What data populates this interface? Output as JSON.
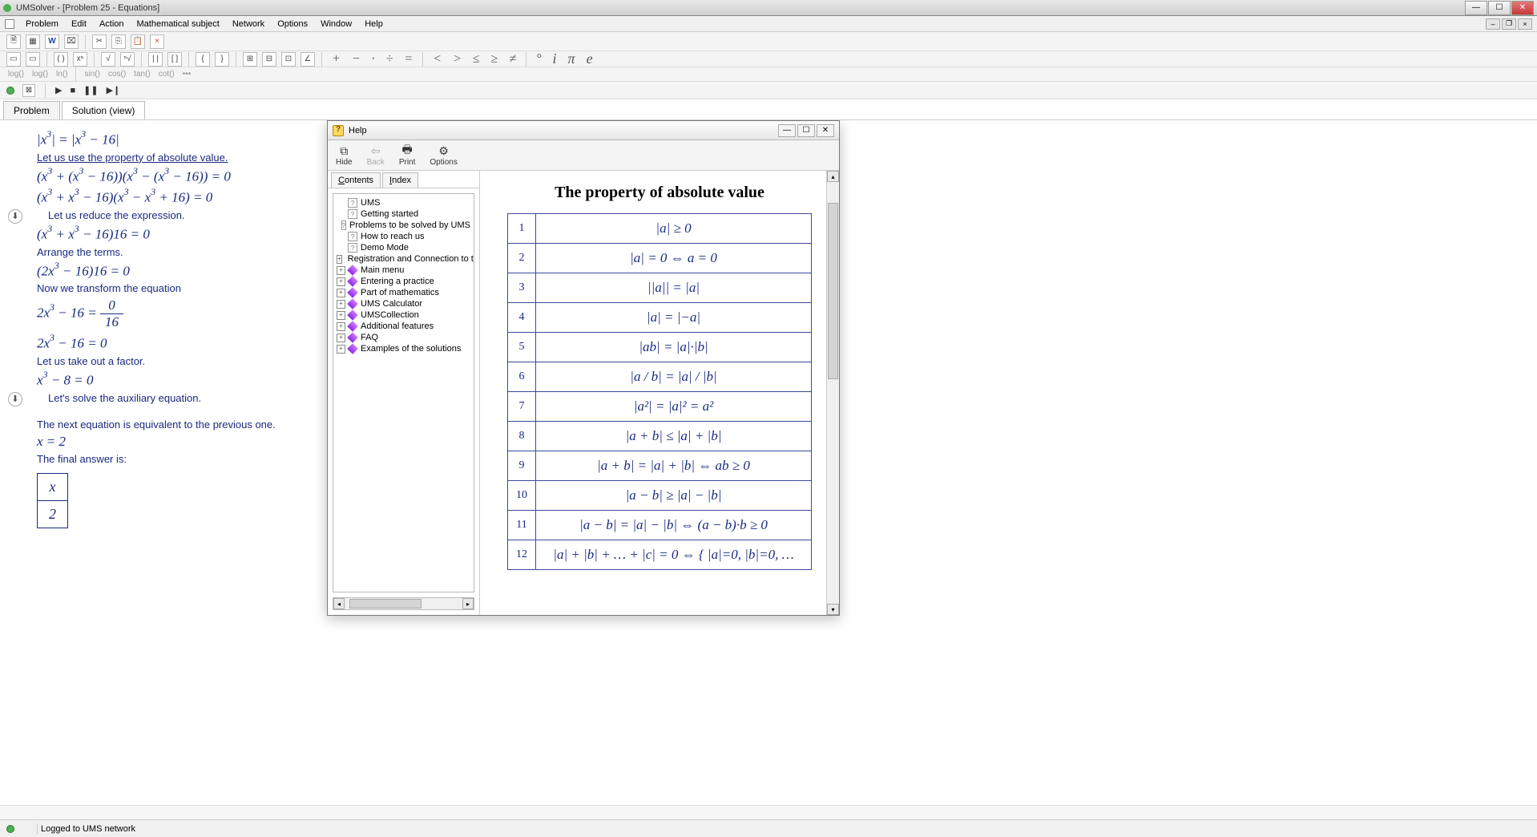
{
  "window": {
    "title": "UMSolver - [Problem 25 - Equations]"
  },
  "menu": {
    "items": [
      "Problem",
      "Edit",
      "Action",
      "Mathematical subject",
      "Network",
      "Options",
      "Window",
      "Help"
    ]
  },
  "toolbar2_funcs": [
    "log()",
    "log()",
    "ln()",
    "sin()",
    "cos()",
    "tan()",
    "cot()",
    "•••"
  ],
  "doc_tabs": {
    "problem": "Problem",
    "solution": "Solution (view)"
  },
  "solution": {
    "eq_top": "|x³| = |x³ − 16|",
    "s1": "Let us use the property of absolute value.",
    "eq2": "(x³ + (x³ − 16))(x³ − (x³ − 16)) = 0",
    "eq3": "(x³ + x³ − 16)(x³ − x³ + 16) = 0",
    "s2": "Let us reduce the expression.",
    "eq4": "(x³ + x³ − 16)16 = 0",
    "s3": "Arrange the terms.",
    "eq5": "(2x³ − 16)16 = 0",
    "s4": "Now we transform the equation",
    "eq6_lhs": "2x³ − 16",
    "eq6_num": "0",
    "eq6_den": "16",
    "eq7": "2x³ − 16 = 0",
    "s5": "Let us take out a factor.",
    "eq8": "x³ − 8 = 0",
    "s6": "Let's solve the auxiliary equation.",
    "s7": "The next equation is equivalent to the previous one.",
    "eq9": "x = 2",
    "s8": "The final answer is:",
    "ans_var": "x",
    "ans_val": "2"
  },
  "help": {
    "title": "Help",
    "toolbar": {
      "hide": "Hide",
      "back": "Back",
      "print": "Print",
      "options": "Options"
    },
    "nav_tabs": {
      "contents": "Contents",
      "index": "Index"
    },
    "tree": [
      {
        "kind": "q",
        "label": "UMS"
      },
      {
        "kind": "q",
        "label": "Getting started"
      },
      {
        "kind": "q",
        "label": "Problems to be solved by UMS"
      },
      {
        "kind": "q",
        "label": "How to reach us"
      },
      {
        "kind": "q",
        "label": "Demo Mode"
      },
      {
        "kind": "b",
        "exp": true,
        "label": "Registration and Connection to the UMS"
      },
      {
        "kind": "b",
        "exp": true,
        "label": "Main menu"
      },
      {
        "kind": "b",
        "exp": true,
        "label": "Entering a practice"
      },
      {
        "kind": "b",
        "exp": true,
        "label": "Part of mathematics"
      },
      {
        "kind": "b",
        "exp": true,
        "label": "UMS Calculator"
      },
      {
        "kind": "b",
        "exp": true,
        "label": "UMSCollection"
      },
      {
        "kind": "b",
        "exp": true,
        "label": "Additional features"
      },
      {
        "kind": "b",
        "exp": true,
        "label": "FAQ"
      },
      {
        "kind": "b",
        "exp": true,
        "label": "Examples of the solutions"
      }
    ],
    "article_title": "The property of absolute value",
    "rows": [
      {
        "n": "1",
        "f": "|a| ≥ 0"
      },
      {
        "n": "2",
        "f": "|a| = 0 ⇔ a = 0"
      },
      {
        "n": "3",
        "f": "||a|| = |a|"
      },
      {
        "n": "4",
        "f": "|a| = |−a|"
      },
      {
        "n": "5",
        "f": "|ab| = |a|·|b|"
      },
      {
        "n": "6",
        "f": "|a / b| = |a| / |b|"
      },
      {
        "n": "7",
        "f": "|a²| = |a|² = a²"
      },
      {
        "n": "8",
        "f": "|a + b| ≤ |a| + |b|"
      },
      {
        "n": "9",
        "f": "|a + b| = |a| + |b| ⇔ ab ≥ 0"
      },
      {
        "n": "10",
        "f": "|a − b| ≥ |a| − |b|"
      },
      {
        "n": "11",
        "f": "|a − b| = |a| − |b| ⇔ (a − b)·b ≥ 0"
      },
      {
        "n": "12",
        "f": "|a| + |b| + … + |c| = 0 ⇔ { |a|=0, |b|=0, …"
      }
    ]
  },
  "status": {
    "text": "Logged to UMS network"
  }
}
